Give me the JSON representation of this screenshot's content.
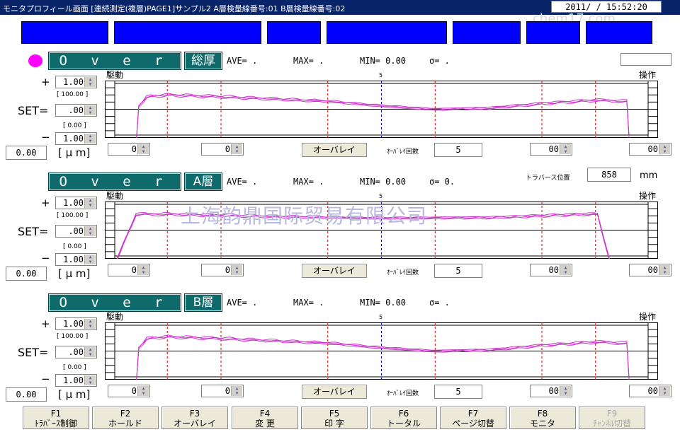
{
  "window": {
    "title": "モニタプロフィール画面 [連続測定(複層)PAGE1]サンプル2 A層検量線番号:01 B層検量線番号:02",
    "clock": "2011/ / 15:52:20"
  },
  "watermarks": {
    "main": "上海韵鼎国际贸易有限公司",
    "corner": "chem17.com"
  },
  "panels": [
    {
      "overlay_label": "O v e r l a y",
      "tag": "総厚",
      "stats": {
        "ave": "AVE= .",
        "max": "MAX= .",
        "min": "MIN= 0.00",
        "sigma": "σ= ."
      },
      "left_label": "駆動",
      "right_label": "操作",
      "center_mark": "5",
      "plus": "+",
      "minus": "−",
      "set_label": "SET=",
      "unit": "[ μ m]",
      "plus_val": "1.00",
      "plus_range": "[ 100.00 ]",
      "set_val": ".00",
      "mid_range": "[ 0.00 ]",
      "minus_val": "1.00",
      "readout": "0.00",
      "bottom": {
        "left": "0",
        "left2": "0",
        "overlay_btn": "オーバレイ",
        "count_label": "ｵｰﾊﾞﾚｲ回数",
        "count": "5",
        "right1": "00",
        "right2": "00"
      },
      "chart_data": {
        "type": "line",
        "ylim": [
          0,
          1
        ],
        "series_offset": 0.4,
        "profile": [
          [
            0.04,
            -0.1
          ],
          [
            0.045,
            0.55
          ],
          [
            0.06,
            0.72
          ],
          [
            0.1,
            0.75
          ],
          [
            0.2,
            0.72
          ],
          [
            0.3,
            0.68
          ],
          [
            0.4,
            0.64
          ],
          [
            0.5,
            0.56
          ],
          [
            0.6,
            0.5
          ],
          [
            0.7,
            0.52
          ],
          [
            0.8,
            0.6
          ],
          [
            0.9,
            0.66
          ],
          [
            0.96,
            0.64
          ],
          [
            0.965,
            -0.1
          ]
        ]
      }
    },
    {
      "overlay_label": "O v e r l a y",
      "tag": "A層",
      "stats": {
        "ave": "AVE= .",
        "max": "MAX= .",
        "min": "MIN= 0.00",
        "sigma": "σ= 0."
      },
      "traverse_label": "トラバース位置",
      "traverse_value": "858",
      "traverse_unit": "mm",
      "left_label": "駆動",
      "right_label": "操作",
      "center_mark": "5",
      "plus": "+",
      "minus": "−",
      "set_label": "SET=",
      "unit": "[ μ m]",
      "plus_val": "1.00",
      "plus_range": "[ 100.00 ]",
      "set_val": ".00",
      "mid_range": "[ 0.00 ]",
      "minus_val": "1.00",
      "readout": "0.00",
      "bottom": {
        "left": "0",
        "left2": "0",
        "overlay_btn": "オーバレイ",
        "count_label": "ｵｰﾊﾞﾚｲ回数",
        "count": "5",
        "right1": "00",
        "right2": "00"
      },
      "chart_data": {
        "type": "line",
        "ylim": [
          0,
          1
        ],
        "profile": [
          [
            0.0,
            -0.1
          ],
          [
            0.04,
            0.78
          ],
          [
            0.1,
            0.78
          ],
          [
            0.3,
            0.74
          ],
          [
            0.5,
            0.71
          ],
          [
            0.7,
            0.72
          ],
          [
            0.88,
            0.78
          ],
          [
            0.905,
            0.78
          ],
          [
            0.93,
            -0.1
          ]
        ]
      }
    },
    {
      "overlay_label": "O v e r l a y",
      "tag": "B層",
      "stats": {
        "ave": "AVE= .",
        "max": "MAX= .",
        "min": "MIN= 0.00",
        "sigma": "σ= ."
      },
      "left_label": "駆動",
      "right_label": "操作",
      "center_mark": "5",
      "plus": "+",
      "minus": "−",
      "set_label": "SET=",
      "unit": "[ μ m]",
      "plus_val": "1.00",
      "plus_range": "[ 100.00 ]",
      "set_val": ".00",
      "mid_range": "[ 0.00 ]",
      "minus_val": "1.00",
      "readout": "0.00",
      "bottom": {
        "left": "0",
        "left2": "0",
        "overlay_btn": "オーバレイ",
        "count_label": "ｵｰﾊﾞﾚｲ回数",
        "count": "5",
        "right1": "00",
        "right2": "00"
      },
      "chart_data": {
        "type": "line",
        "ylim": [
          0,
          1
        ],
        "profile": [
          [
            0.04,
            -0.1
          ],
          [
            0.045,
            0.55
          ],
          [
            0.06,
            0.72
          ],
          [
            0.1,
            0.75
          ],
          [
            0.2,
            0.72
          ],
          [
            0.3,
            0.68
          ],
          [
            0.4,
            0.64
          ],
          [
            0.5,
            0.56
          ],
          [
            0.6,
            0.5
          ],
          [
            0.7,
            0.52
          ],
          [
            0.8,
            0.6
          ],
          [
            0.9,
            0.66
          ],
          [
            0.96,
            0.64
          ],
          [
            0.965,
            -0.1
          ]
        ]
      }
    }
  ],
  "fkeys": [
    {
      "key": "F1",
      "label": "ﾄﾗﾊﾞｰｽ制御",
      "enabled": true
    },
    {
      "key": "F2",
      "label": "ホールド",
      "enabled": true
    },
    {
      "key": "F3",
      "label": "オーバレイ",
      "enabled": true
    },
    {
      "key": "F4",
      "label": "変 更",
      "enabled": true
    },
    {
      "key": "F5",
      "label": "印 字",
      "enabled": true
    },
    {
      "key": "F6",
      "label": "トータル",
      "enabled": true
    },
    {
      "key": "F7",
      "label": "ページ切替",
      "enabled": true
    },
    {
      "key": "F8",
      "label": "モニタ",
      "enabled": true
    },
    {
      "key": "F9",
      "label": "ﾁｬﾝﾈﾙ切替",
      "enabled": false
    }
  ],
  "colors": {
    "title_bg": "#0a246a",
    "blue_box": "#0000ff",
    "overlay_bg": "#0f6b6b",
    "trace": "#cc33cc",
    "indicator": "#ff00ff"
  }
}
